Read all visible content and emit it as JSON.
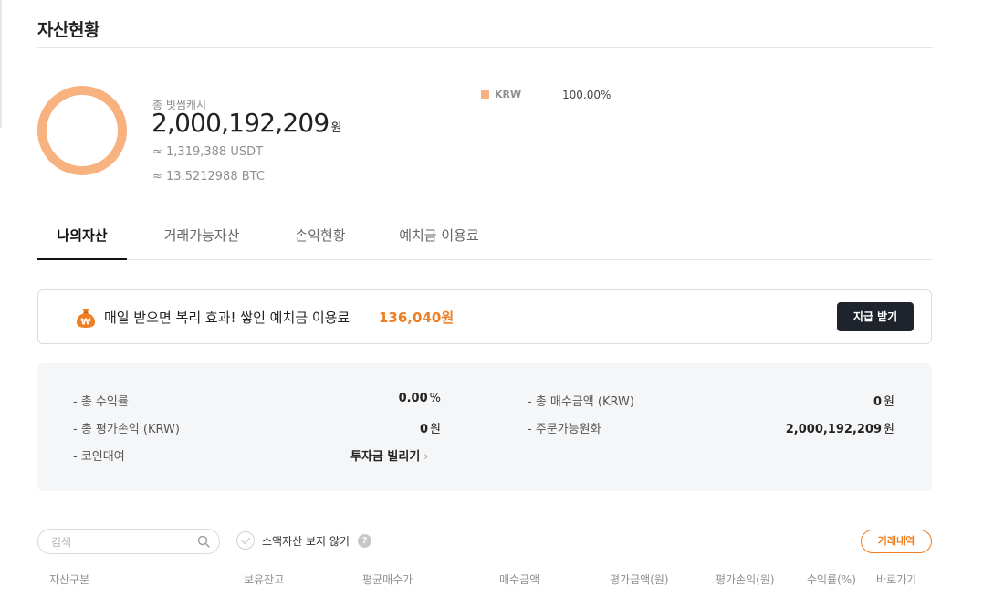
{
  "page": {
    "title": "자산현황"
  },
  "overview": {
    "total_label": "총 빗썸캐시",
    "total_amount": "2,000,192,209",
    "total_unit": "원",
    "approx_usdt": "≈ 1,319,388 USDT",
    "approx_btc": "≈ 13.5212988 BTC",
    "donut_color": "#f7b27f",
    "allocation": [
      {
        "name": "KRW",
        "percent_text": "100.00%",
        "percent": 100,
        "color": "#f7b27f"
      }
    ]
  },
  "tabs": [
    {
      "label": "나의자산",
      "active": true
    },
    {
      "label": "거래가능자산",
      "active": false
    },
    {
      "label": "손익현황",
      "active": false
    },
    {
      "label": "예치금 이용료",
      "active": false
    }
  ],
  "promo": {
    "icon": "money-bag-icon",
    "text": "매일 받으면 복리 효과! 쌓인 예치금 이용료",
    "amount": "136,040원",
    "button_label": "지급 받기",
    "accent_color": "#ef7d22"
  },
  "summary": {
    "left": [
      {
        "label": "- 총 수익률",
        "value": "0.00",
        "unit": "%"
      },
      {
        "label": "- 총 평가손익 (KRW)",
        "value": "0",
        "unit": "원"
      },
      {
        "label": "- 코인대여",
        "link_label": "투자금 빌리기",
        "link_icon": "chevron-right-icon"
      }
    ],
    "right": [
      {
        "label": "- 총 매수금액 (KRW)",
        "value": "0",
        "unit": "원"
      },
      {
        "label": "- 주문가능원화",
        "value": "2,000,192,209",
        "unit": "원"
      }
    ]
  },
  "filters": {
    "search_placeholder": "검색",
    "search_icon": "search-icon",
    "hide_small_label": "소액자산 보지 않기",
    "help_icon": "question-icon",
    "history_button": "거래내역"
  },
  "table": {
    "headers": [
      "자산구분",
      "보유잔고",
      "평균매수가",
      "매수금액",
      "평가금액(원)",
      "평가손익(원)",
      "수익률(%)",
      "바로가기"
    ]
  }
}
